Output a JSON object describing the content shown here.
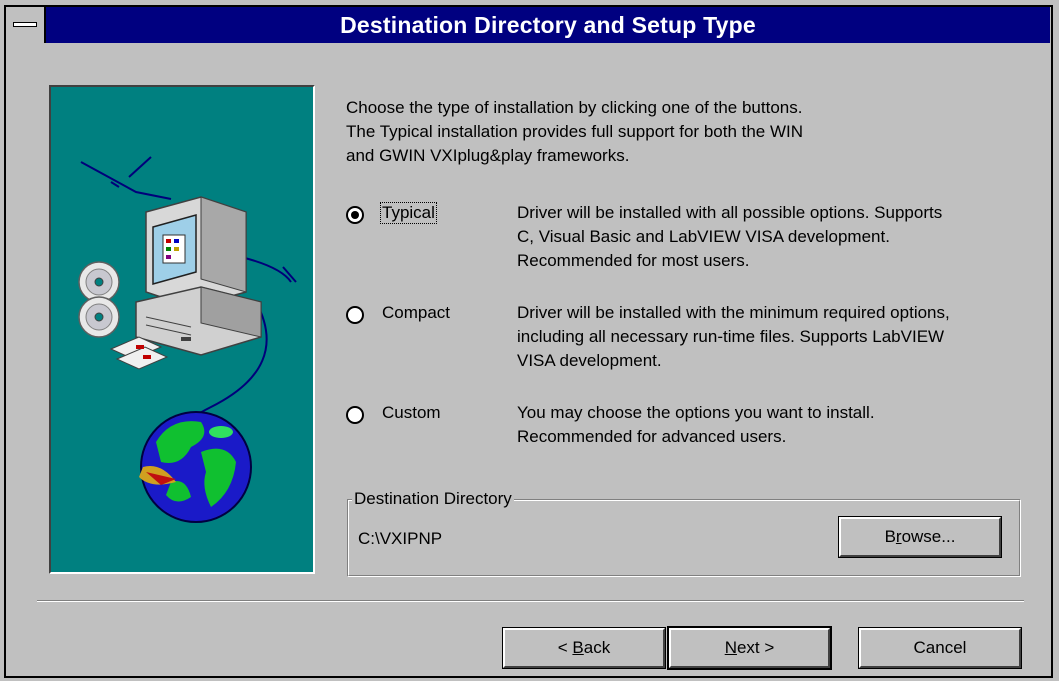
{
  "window": {
    "title": "Destination Directory and Setup Type"
  },
  "intro": {
    "line1": "Choose the type of installation by clicking one of the buttons.",
    "line2": "The Typical installation provides full support for both the WIN",
    "line3": "and GWIN VXIplug&play frameworks."
  },
  "options": [
    {
      "label": "Typical",
      "selected": true,
      "desc1": "Driver will be installed with all possible options.  Supports",
      "desc2": "C, Visual Basic and LabVIEW VISA development.",
      "desc3": "Recommended for most users."
    },
    {
      "label": "Compact",
      "selected": false,
      "desc1": "Driver will be installed with the minimum required options,",
      "desc2": "including all necessary run-time files.  Supports LabVIEW",
      "desc3": "VISA development."
    },
    {
      "label": "Custom",
      "selected": false,
      "desc1": "You may choose the options you want to install.",
      "desc2": "Recommended for advanced users."
    }
  ],
  "destination": {
    "group_title": "Destination Directory",
    "path": "C:\\VXIPNP",
    "browse_pre": "B",
    "browse_ul": "r",
    "browse_post": "owse..."
  },
  "buttons": {
    "back_pre": "< ",
    "back_ul": "B",
    "back_post": "ack",
    "next_ul": "N",
    "next_post": "ext >",
    "cancel": "Cancel"
  },
  "colors": {
    "titlebar": "#000080",
    "face": "#c0c0c0",
    "picture_bg": "#008080"
  }
}
